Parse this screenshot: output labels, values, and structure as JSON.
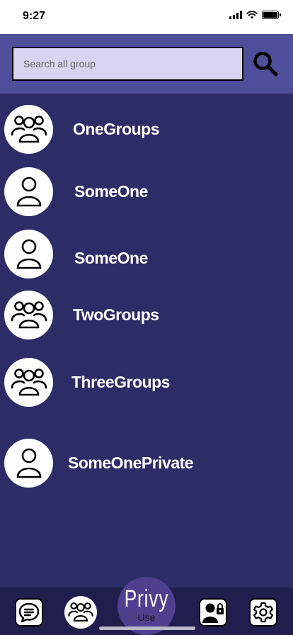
{
  "status_bar": {
    "time": "9:27"
  },
  "search": {
    "placeholder": "Search all group",
    "value": ""
  },
  "items": [
    {
      "label": "OneGroups",
      "icon": "group-icon"
    },
    {
      "label": "SomeOne",
      "icon": "person-icon"
    },
    {
      "label": "SomeOne",
      "icon": "person-icon"
    },
    {
      "label": "TwoGroups",
      "icon": "group-icon"
    },
    {
      "label": "ThreeGroups",
      "icon": "group-icon"
    },
    {
      "label": "SomeOnePrivate",
      "icon": "person-icon"
    }
  ],
  "bottom_nav": {
    "logo_title": "Privy",
    "logo_sub": "Use",
    "buttons": [
      "chat-icon",
      "groups-icon",
      "private-contact-icon",
      "settings-icon"
    ]
  },
  "colors": {
    "background": "#2d2c66",
    "search_bar": "#4f4e9a",
    "search_field": "#d6d4ef",
    "bottom_nav": "#1f1e4c",
    "logo": "#4f3f8f"
  }
}
